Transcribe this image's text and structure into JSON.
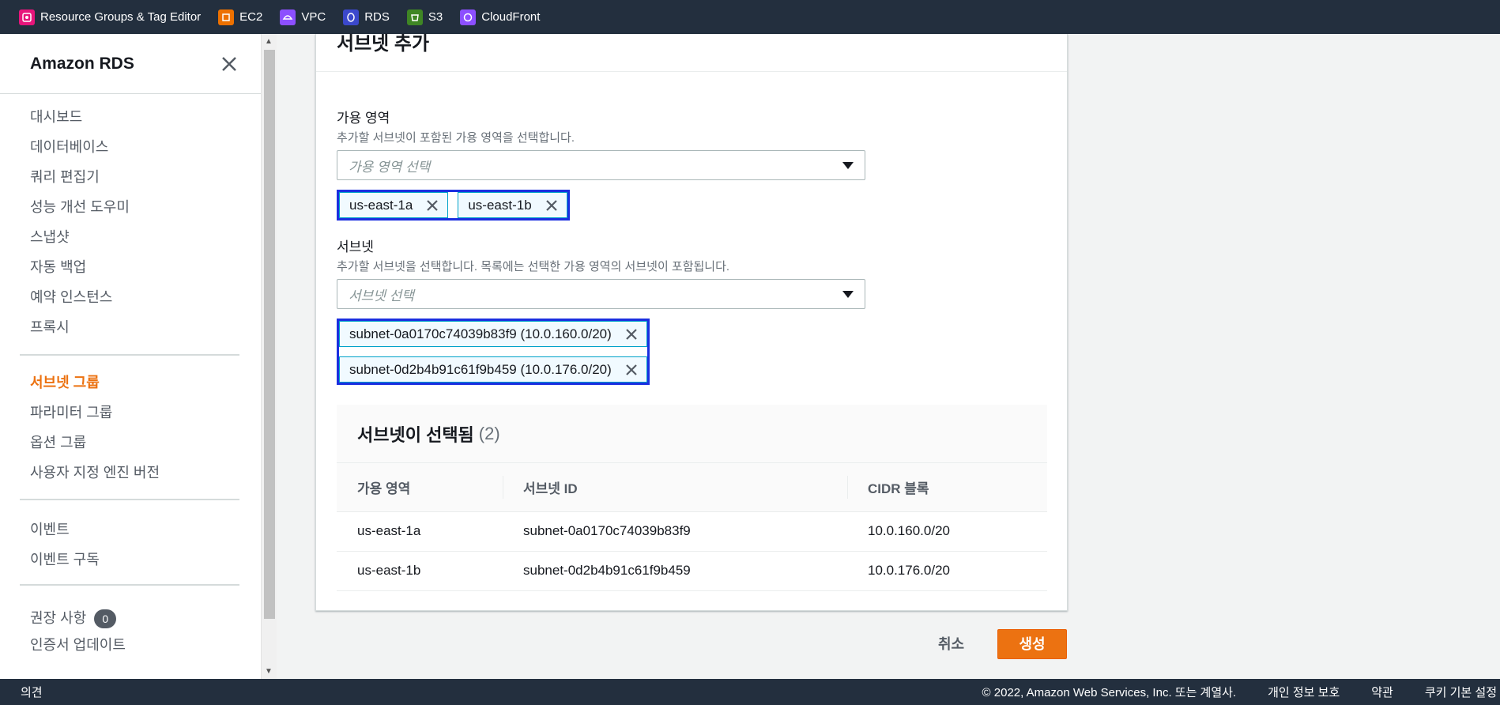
{
  "topbar": {
    "favorites": [
      {
        "label": "Resource Groups & Tag Editor",
        "color": "#e7157b",
        "icon": "resource-groups-icon"
      },
      {
        "label": "EC2",
        "color": "#ed7100",
        "icon": "ec2-icon"
      },
      {
        "label": "VPC",
        "color": "#8c4fff",
        "icon": "vpc-icon"
      },
      {
        "label": "RDS",
        "color": "#3b48cc",
        "icon": "rds-icon"
      },
      {
        "label": "S3",
        "color": "#3f8624",
        "icon": "s3-icon"
      },
      {
        "label": "CloudFront",
        "color": "#8c4fff",
        "icon": "cloudfront-icon"
      }
    ]
  },
  "sidebar": {
    "title": "Amazon RDS",
    "items_group1": [
      "대시보드",
      "데이터베이스",
      "쿼리 편집기",
      "성능 개선 도우미",
      "스냅샷",
      "자동 백업",
      "예약 인스턴스",
      "프록시"
    ],
    "items_group2": [
      "서브넷 그룹",
      "파라미터 그룹",
      "옵션 그룹",
      "사용자 지정 엔진 버전"
    ],
    "items_group3": [
      "이벤트",
      "이벤트 구독"
    ],
    "recommendations": {
      "label": "권장 사항",
      "count": "0"
    },
    "cut_item": "인증서 업데이트"
  },
  "panel": {
    "title": "서브넷 추가",
    "az": {
      "label": "가용 영역",
      "description": "추가할 서브넷이 포함된 가용 영역을 선택합니다.",
      "placeholder": "가용 영역 선택",
      "tokens": [
        "us-east-1a",
        "us-east-1b"
      ]
    },
    "subnet": {
      "label": "서브넷",
      "description": "추가할 서브넷을 선택합니다. 목록에는 선택한 가용 영역의 서브넷이 포함됩니다.",
      "placeholder": "서브넷 선택",
      "tokens": [
        "subnet-0a0170c74039b83f9 (10.0.160.0/20)",
        "subnet-0d2b4b91c61f9b459 (10.0.176.0/20)"
      ]
    },
    "selected": {
      "title": "서브넷이 선택됨",
      "count": "(2)",
      "columns": [
        "가용 영역",
        "서브넷 ID",
        "CIDR 블록"
      ],
      "rows": [
        [
          "us-east-1a",
          "subnet-0a0170c74039b83f9",
          "10.0.160.0/20"
        ],
        [
          "us-east-1b",
          "subnet-0d2b4b91c61f9b459",
          "10.0.176.0/20"
        ]
      ]
    }
  },
  "actions": {
    "cancel": "취소",
    "create": "생성"
  },
  "footer": {
    "feedback": "의견",
    "copyright": "© 2022, Amazon Web Services, Inc. 또는 계열사.",
    "privacy": "개인 정보 보호",
    "terms": "약관",
    "cookies": "쿠키 기본 설정"
  }
}
